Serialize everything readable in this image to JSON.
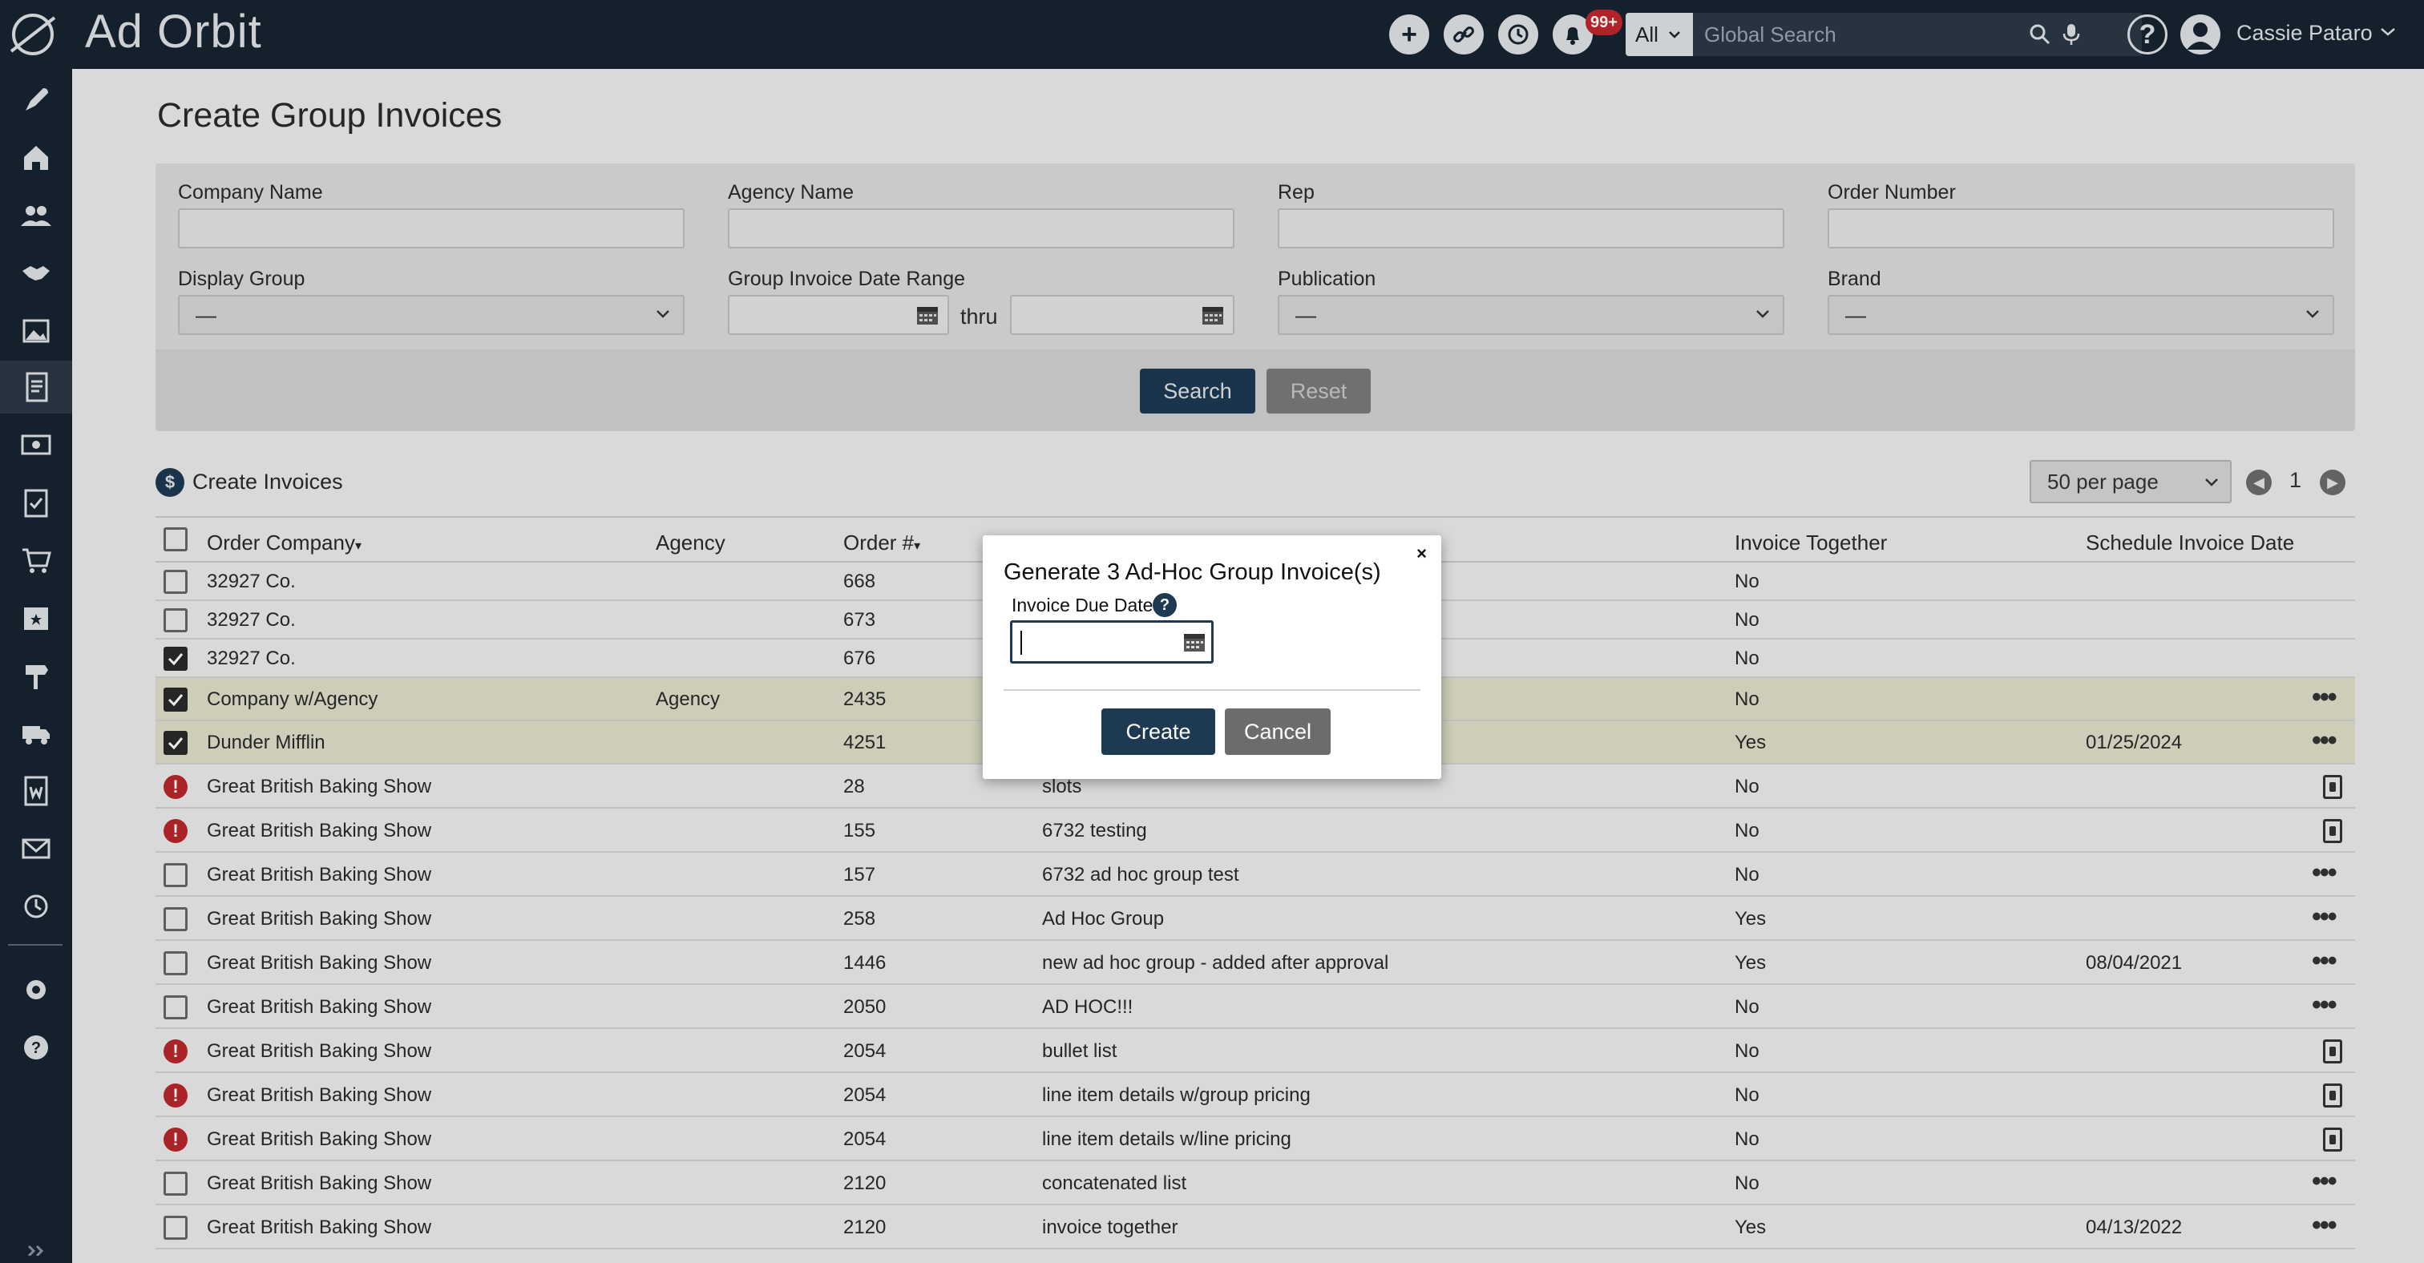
{
  "app": {
    "logo_text": "Ad Orbit"
  },
  "topbar": {
    "notification_count": "99+",
    "search_scope": "All",
    "search_placeholder": "Global Search",
    "user_name": "Cassie Pataro"
  },
  "page": {
    "title": "Create Group Invoices"
  },
  "filters": {
    "company_name_label": "Company Name",
    "agency_name_label": "Agency Name",
    "rep_label": "Rep",
    "order_number_label": "Order Number",
    "display_group_label": "Display Group",
    "display_group_value": "—",
    "date_range_label": "Group Invoice Date Range",
    "thru_label": "thru",
    "publication_label": "Publication",
    "publication_value": "—",
    "brand_label": "Brand",
    "brand_value": "—",
    "search_button": "Search",
    "reset_button": "Reset"
  },
  "results": {
    "title": "Create Invoices",
    "per_page": "50 per page",
    "page_number": "1",
    "columns": {
      "order_company": "Order Company",
      "agency": "Agency",
      "order_num": "Order #",
      "invoice_together": "Invoice Together",
      "schedule_date": "Schedule Invoice Date"
    },
    "rows": [
      {
        "status": "unchecked",
        "company": "32927 Co.",
        "agency": "",
        "order": "668",
        "name": "",
        "together": "No",
        "date": "",
        "action": "none"
      },
      {
        "status": "unchecked",
        "company": "32927 Co.",
        "agency": "",
        "order": "673",
        "name": "",
        "together": "No",
        "date": "",
        "action": "none"
      },
      {
        "status": "checked",
        "company": "32927 Co.",
        "agency": "",
        "order": "676",
        "name": "",
        "together": "No",
        "date": "",
        "action": "none"
      },
      {
        "status": "checked",
        "company": "Company w/Agency",
        "agency": "Agency",
        "order": "2435",
        "name": "",
        "together": "No",
        "date": "",
        "action": "menu"
      },
      {
        "status": "checked",
        "company": "Dunder Mifflin",
        "agency": "",
        "order": "4251",
        "name": "",
        "together": "Yes",
        "date": "01/25/2024",
        "action": "menu"
      },
      {
        "status": "warning",
        "company": "Great British Baking Show",
        "agency": "",
        "order": "28",
        "name": "slots",
        "together": "No",
        "date": "",
        "action": "invoice"
      },
      {
        "status": "warning",
        "company": "Great British Baking Show",
        "agency": "",
        "order": "155",
        "name": "6732 testing",
        "together": "No",
        "date": "",
        "action": "invoice"
      },
      {
        "status": "unchecked",
        "company": "Great British Baking Show",
        "agency": "",
        "order": "157",
        "name": "6732 ad hoc group test",
        "together": "No",
        "date": "",
        "action": "menu"
      },
      {
        "status": "unchecked",
        "company": "Great British Baking Show",
        "agency": "",
        "order": "258",
        "name": "Ad Hoc Group",
        "together": "Yes",
        "date": "",
        "action": "menu"
      },
      {
        "status": "unchecked",
        "company": "Great British Baking Show",
        "agency": "",
        "order": "1446",
        "name": "new ad hoc group - added after approval",
        "together": "Yes",
        "date": "08/04/2021",
        "action": "menu"
      },
      {
        "status": "unchecked",
        "company": "Great British Baking Show",
        "agency": "",
        "order": "2050",
        "name": "AD HOC!!!",
        "together": "No",
        "date": "",
        "action": "menu"
      },
      {
        "status": "warning",
        "company": "Great British Baking Show",
        "agency": "",
        "order": "2054",
        "name": "bullet list",
        "together": "No",
        "date": "",
        "action": "invoice"
      },
      {
        "status": "warning",
        "company": "Great British Baking Show",
        "agency": "",
        "order": "2054",
        "name": "line item details w/group pricing",
        "together": "No",
        "date": "",
        "action": "invoice"
      },
      {
        "status": "warning",
        "company": "Great British Baking Show",
        "agency": "",
        "order": "2054",
        "name": "line item details w/line pricing",
        "together": "No",
        "date": "",
        "action": "invoice"
      },
      {
        "status": "unchecked",
        "company": "Great British Baking Show",
        "agency": "",
        "order": "2120",
        "name": "concatenated list",
        "together": "No",
        "date": "",
        "action": "menu"
      },
      {
        "status": "unchecked",
        "company": "Great British Baking Show",
        "agency": "",
        "order": "2120",
        "name": "invoice together",
        "together": "Yes",
        "date": "04/13/2022",
        "action": "menu"
      }
    ]
  },
  "modal": {
    "title": "Generate 3 Ad-Hoc Group Invoice(s)",
    "close": "×",
    "due_date_label": "Invoice Due Date",
    "help": "?",
    "create_button": "Create",
    "cancel_button": "Cancel"
  }
}
